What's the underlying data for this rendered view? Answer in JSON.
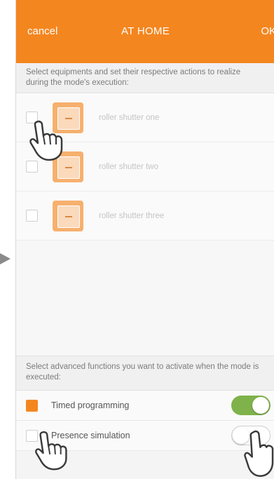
{
  "header": {
    "cancel_label": "cancel",
    "title": "AT HOME",
    "ok_label": "OK",
    "background": "#f4861f"
  },
  "equipment_hint": "Select equipments and set their respective actions to realize during the mode's execution:",
  "equipment": [
    {
      "name": "roller shutter one",
      "icon": "roller-shutter-icon",
      "checked": false
    },
    {
      "name": "roller shutter two",
      "icon": "roller-shutter-icon",
      "checked": false
    },
    {
      "name": "roller shutter three",
      "icon": "roller-shutter-icon",
      "checked": false
    }
  ],
  "advanced_hint": "Select advanced functions you want to activate when the mode is executed:",
  "advanced": [
    {
      "label": "Timed programming",
      "checked": true,
      "toggle": "on"
    },
    {
      "label": "Presence simulation",
      "checked": false,
      "toggle": "off"
    }
  ],
  "colors": {
    "accent": "#f4861f",
    "toggle_on": "#7fb24a"
  }
}
